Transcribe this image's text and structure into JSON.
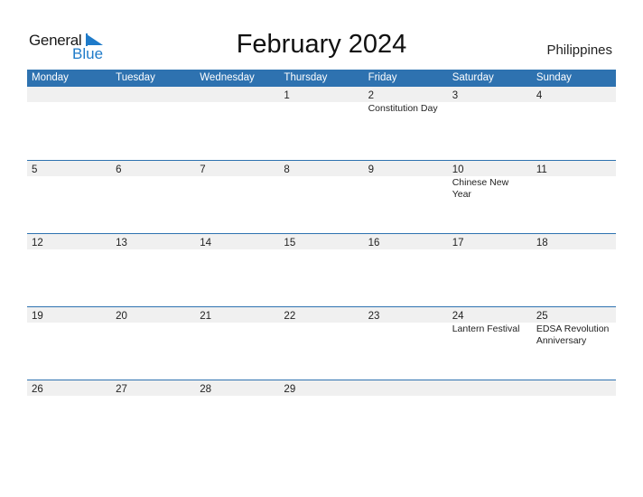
{
  "logo": {
    "word1": "General",
    "word2": "Blue"
  },
  "header": {
    "title": "February 2024",
    "country": "Philippines"
  },
  "colors": {
    "accent": "#2e72b0",
    "row_bg": "#f0f0f0",
    "logo_blue": "#1f7bc9"
  },
  "weekdays": [
    "Monday",
    "Tuesday",
    "Wednesday",
    "Thursday",
    "Friday",
    "Saturday",
    "Sunday"
  ],
  "weeks": [
    {
      "days": [
        "",
        "",
        "",
        "1",
        "2",
        "3",
        "4"
      ],
      "events": [
        "",
        "",
        "",
        "",
        "Constitution Day",
        "",
        ""
      ]
    },
    {
      "days": [
        "5",
        "6",
        "7",
        "8",
        "9",
        "10",
        "11"
      ],
      "events": [
        "",
        "",
        "",
        "",
        "",
        "Chinese New Year",
        ""
      ]
    },
    {
      "days": [
        "12",
        "13",
        "14",
        "15",
        "16",
        "17",
        "18"
      ],
      "events": [
        "",
        "",
        "",
        "",
        "",
        "",
        ""
      ]
    },
    {
      "days": [
        "19",
        "20",
        "21",
        "22",
        "23",
        "24",
        "25"
      ],
      "events": [
        "",
        "",
        "",
        "",
        "",
        "Lantern Festival",
        "EDSA Revolution Anniversary"
      ]
    },
    {
      "days": [
        "26",
        "27",
        "28",
        "29",
        "",
        "",
        ""
      ],
      "events": [
        "",
        "",
        "",
        "",
        "",
        "",
        ""
      ]
    }
  ]
}
